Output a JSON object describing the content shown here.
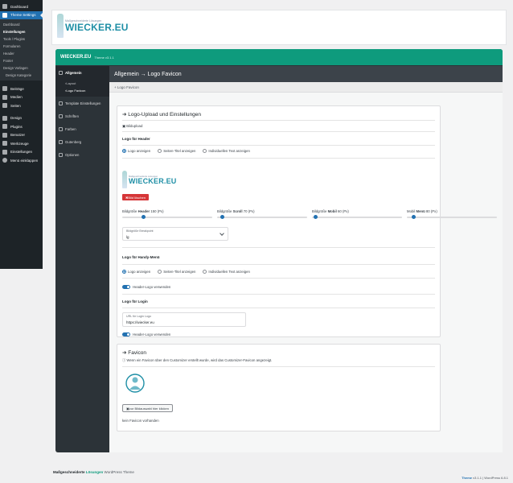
{
  "wp_menu": {
    "items_top": [
      {
        "label": "Dashboard",
        "icon": "dashboard-icon"
      },
      {
        "label": "Theme Settings",
        "icon": "theme-settings-icon",
        "active": true
      }
    ],
    "sub_items": [
      "Dashboard",
      "Einstellungen",
      "Tools / Plugins",
      "Formularen",
      "Header",
      "Footer",
      "Design Vorlagen",
      "Design Kategorie"
    ],
    "items_bottom": [
      {
        "label": "Beiträge",
        "icon": "pin-icon"
      },
      {
        "label": "Medien",
        "icon": "media-icon"
      },
      {
        "label": "Seiten",
        "icon": "pages-icon"
      },
      {
        "label": "Design",
        "icon": "brush-icon"
      },
      {
        "label": "Plugins",
        "icon": "plugin-icon"
      },
      {
        "label": "Benutzer",
        "icon": "user-icon"
      },
      {
        "label": "Werkzeuge",
        "icon": "wrench-icon"
      },
      {
        "label": "Einstellungen",
        "icon": "settings-icon"
      },
      {
        "label": "Menü einklappen",
        "icon": "collapse-icon"
      }
    ]
  },
  "logo": {
    "small": "Maßgeschneiderte Lösungen",
    "big": "WIECKER.EU"
  },
  "panel": {
    "brand": "WIECKER.EU",
    "version": "Theme v3.1.1",
    "nav": [
      {
        "label": "Allgemein",
        "icon": "x-icon"
      },
      {
        "label": "Template Einstellungen",
        "icon": "template-icon"
      },
      {
        "label": "Schriften",
        "icon": "font-icon"
      },
      {
        "label": "Farben",
        "icon": "color-icon"
      },
      {
        "label": "Gutenberg",
        "icon": "gutenberg-icon"
      },
      {
        "label": "Optionen",
        "icon": "options-icon"
      }
    ],
    "nav_sub": [
      "Layout",
      "Logo Favicon"
    ],
    "title": "Allgemein → Logo Favicon",
    "breadcrumb": "+ Logo Favicon"
  },
  "logo_card": {
    "title": "Logo-Upload und Einstellungen",
    "upload_label": "Bildupload",
    "header_label": "Logo für Header",
    "header_options": [
      "Logo anzeigen",
      "Seiten-Titel anzeigen",
      "Individuellen Text anzeigen"
    ],
    "delete_button": "Bild löschen",
    "sliders": [
      {
        "prefix": "Bildgröße",
        "bold": "Header",
        "value": "150 (Px)",
        "fraction": 0.24
      },
      {
        "prefix": "Bildgröße",
        "bold": "Scroll",
        "value": "70 (Px)",
        "fraction": 0.06
      },
      {
        "prefix": "Bildgröße",
        "bold": "Mobil",
        "value": "60 (Px)",
        "fraction": 0.04
      },
      {
        "prefix": "Mobil",
        "bold": "Menü",
        "value": "80 (Px)",
        "fraction": 0.08
      }
    ],
    "breakpoint": {
      "caption": "Bildgröße Breakpoint",
      "value": "lg"
    },
    "handy_label": "Logo für Handy-Menü",
    "handy_options": [
      "Logo anzeigen",
      "Seiten-Titel anzeigen",
      "Individuellen Text anzeigen"
    ],
    "handy_toggle": "Header-Logo verwenden",
    "login_label": "Logo für Login",
    "login_url": {
      "caption": "URL für Login Logo",
      "value": "https://wiecker.eu"
    },
    "login_toggle": "Header-Logo verwenden"
  },
  "favicon_card": {
    "title": "Favicon",
    "note": "Wenn ein Favicon über den Customizer erstellt wurde, wird das Customizer-Favicon angezeigt.",
    "select_button": "zur Bildauswahl hier klicken",
    "empty": "kein Favicon vorhanden"
  },
  "footer": {
    "left_a": "Maßgeschneiderte",
    "left_b": "Lösungen",
    "left_c": "WordPress Theme",
    "right_a": "Theme",
    "right_b": "v3.1.1 | WordPress 6.8.1"
  },
  "colors": {
    "accent": "#0e9b7d",
    "primary": "#2271b1",
    "danger": "#d63638"
  }
}
